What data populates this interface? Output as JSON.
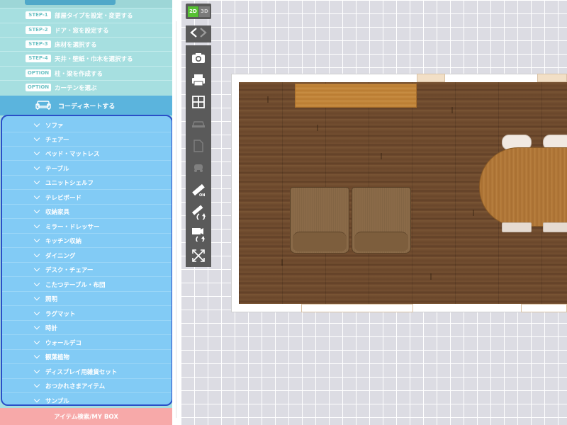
{
  "sidebar": {
    "steps": [
      {
        "badge": "STEP-1",
        "label": "部屋タイプを設定・変更する"
      },
      {
        "badge": "STEP-2",
        "label": "ドア・窓を設定する"
      },
      {
        "badge": "STEP-3",
        "label": "床材を選択する"
      },
      {
        "badge": "STEP-4",
        "label": "天井・壁紙・巾木を選択する"
      },
      {
        "badge": "OPTION",
        "label": "柱・梁を作成する"
      },
      {
        "badge": "OPTION",
        "label": "カーテンを選ぶ"
      }
    ],
    "coordinate_label": "コーディネートする",
    "categories": [
      "ソファ",
      "チェアー",
      "ベッド・マットレス",
      "テーブル",
      "ユニットシェルフ",
      "テレビボード",
      "収納家具",
      "ミラー・ドレッサー",
      "キッチン収納",
      "ダイニング",
      "デスク・チェアー",
      "こたつテーブル・布団",
      "照明",
      "ラグマット",
      "時計",
      "ウォールデコ",
      "観葉植物",
      "ディスプレイ用雑貨セット",
      "おつかれさまアイテム",
      "サンプル"
    ],
    "search_label": "アイテム検索/MY BOX"
  },
  "toolbar": {
    "mode_2d": "2D",
    "mode_3d": "3D",
    "tools": [
      "camera-icon",
      "print-icon",
      "grid-layout-icon",
      "car-icon",
      "document-icon",
      "vehicle-icon",
      "measure-on-icon",
      "measure-rotate-icon",
      "camera-rotate-icon",
      "fit-screen-icon"
    ]
  },
  "colors": {
    "step_panel": "#a6dfe0",
    "coordinate_bar": "#5bb4dd",
    "category_panel": "#82cbf5",
    "category_border": "#2a4fc8",
    "search_bar": "#f7a9a9",
    "active_mode": "#56c132"
  }
}
